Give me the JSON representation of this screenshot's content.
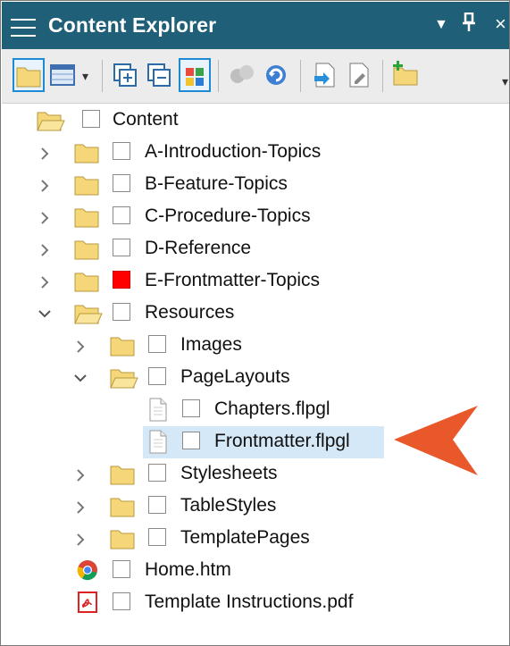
{
  "window": {
    "title": "Content Explorer",
    "controls": {
      "dropdown": "▼",
      "pin": "ᛘ",
      "close": "×"
    }
  },
  "toolbar": {
    "buttons": [
      "open-folder-icon",
      "table-view-icon",
      "expand-all-icon",
      "collapse-all-icon",
      "color-grid-icon",
      "bind-icon",
      "refresh-icon",
      "import-icon",
      "properties-icon",
      "add-folder-icon"
    ]
  },
  "tree": {
    "root": "Content",
    "folders": [
      {
        "label": "A-Introduction-Topics"
      },
      {
        "label": "B-Feature-Topics"
      },
      {
        "label": "C-Procedure-Topics"
      },
      {
        "label": "D-Reference"
      },
      {
        "label": "E-Frontmatter-Topics",
        "flag_color": "#ff0000"
      },
      {
        "label": "Resources"
      }
    ],
    "resources_children": [
      {
        "label": "Images"
      },
      {
        "label": "PageLayouts"
      },
      {
        "label": "Stylesheets"
      },
      {
        "label": "TableStyles"
      },
      {
        "label": "TemplatePages"
      }
    ],
    "pagelayouts_files": [
      {
        "label": "Chapters.flpgl"
      },
      {
        "label": "Frontmatter.flpgl",
        "selected": true
      }
    ],
    "root_files": [
      {
        "label": "Home.htm",
        "icon": "chrome-icon"
      },
      {
        "label": "Template Instructions.pdf",
        "icon": "pdf-icon"
      }
    ]
  },
  "colors": {
    "titlebar": "#1f5f77",
    "selection": "#d5e8f7",
    "pointer_arrow": "#e8582a",
    "folder": "#f5d77a"
  }
}
